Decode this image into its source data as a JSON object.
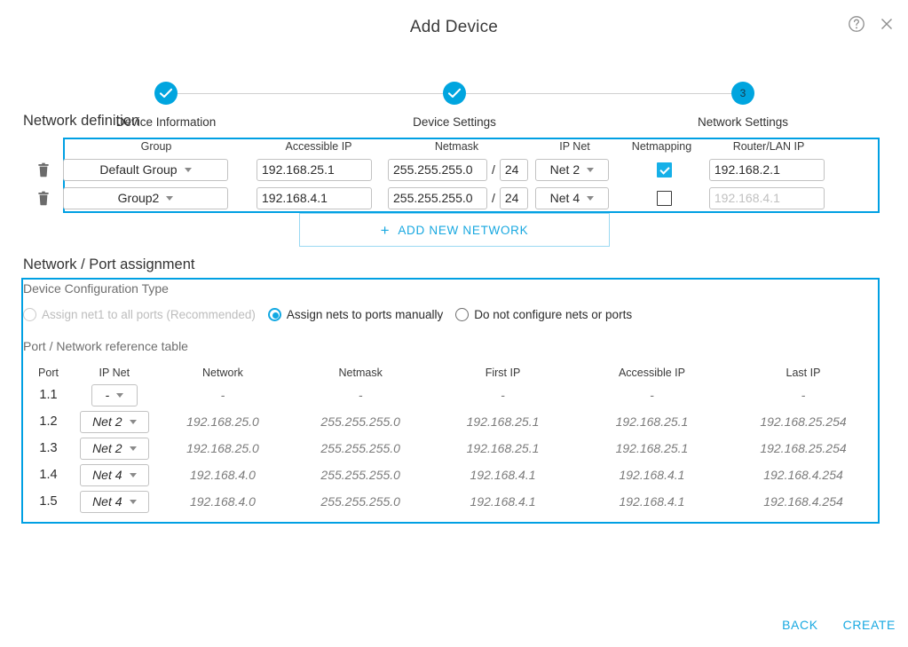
{
  "window": {
    "title": "Add Device",
    "help_icon": "help-circle-icon",
    "close_icon": "close-icon"
  },
  "colors": {
    "accent": "#00a0e3",
    "accent_bright": "#16b0e8",
    "link": "#19a9e1",
    "disabled_text": "#bdbdbd",
    "value_text": "#7b7b7b"
  },
  "stepper": {
    "steps": [
      {
        "label": "Device Information",
        "state": "complete",
        "marker": "check"
      },
      {
        "label": "Device Settings",
        "state": "complete",
        "marker": "check"
      },
      {
        "label": "Network Settings",
        "state": "current",
        "marker": "3"
      }
    ]
  },
  "network_definition": {
    "heading": "Network definition",
    "columns": [
      "Group",
      "Accessible IP",
      "Netmask",
      "IP Net",
      "Netmapping",
      "Router/LAN IP"
    ],
    "slash": "/",
    "rows": [
      {
        "delete_icon": "trash-icon",
        "group": "Default Group",
        "accessible_ip": "192.168.25.1",
        "netmask": "255.255.255.0",
        "cidr": "24",
        "ip_net": "Net 2",
        "netmapping": true,
        "router_lan_ip": "192.168.2.1",
        "router_lan_ip_is_placeholder": false
      },
      {
        "delete_icon": "trash-icon",
        "group": "Group2",
        "accessible_ip": "192.168.4.1",
        "netmask": "255.255.255.0",
        "cidr": "24",
        "ip_net": "Net 4",
        "netmapping": false,
        "router_lan_ip": "192.168.4.1",
        "router_lan_ip_is_placeholder": true
      }
    ],
    "add_button": {
      "label": "ADD NEW NETWORK",
      "icon": "plus-icon"
    }
  },
  "port_assignment": {
    "heading": "Network / Port assignment",
    "config_type_label": "Device Configuration Type",
    "options": [
      {
        "label": "Assign net1 to all ports (Recommended)",
        "selected": false,
        "disabled": true
      },
      {
        "label": "Assign nets to ports manually",
        "selected": true,
        "disabled": false
      },
      {
        "label": "Do not configure nets or ports",
        "selected": false,
        "disabled": false
      }
    ],
    "reference_table_label": "Port / Network reference table",
    "table": {
      "columns": [
        "Port",
        "IP Net",
        "Network",
        "Netmask",
        "First IP",
        "Accessible IP",
        "Last IP"
      ],
      "rows": [
        {
          "port": "1.1",
          "ip_net": "-",
          "network": "-",
          "netmask": "-",
          "first_ip": "-",
          "accessible_ip": "-",
          "last_ip": "-"
        },
        {
          "port": "1.2",
          "ip_net": "Net 2",
          "network": "192.168.25.0",
          "netmask": "255.255.255.0",
          "first_ip": "192.168.25.1",
          "accessible_ip": "192.168.25.1",
          "last_ip": "192.168.25.254"
        },
        {
          "port": "1.3",
          "ip_net": "Net 2",
          "network": "192.168.25.0",
          "netmask": "255.255.255.0",
          "first_ip": "192.168.25.1",
          "accessible_ip": "192.168.25.1",
          "last_ip": "192.168.25.254"
        },
        {
          "port": "1.4",
          "ip_net": "Net 4",
          "network": "192.168.4.0",
          "netmask": "255.255.255.0",
          "first_ip": "192.168.4.1",
          "accessible_ip": "192.168.4.1",
          "last_ip": "192.168.4.254"
        },
        {
          "port": "1.5",
          "ip_net": "Net 4",
          "network": "192.168.4.0",
          "netmask": "255.255.255.0",
          "first_ip": "192.168.4.1",
          "accessible_ip": "192.168.4.1",
          "last_ip": "192.168.4.254"
        }
      ]
    }
  },
  "footer": {
    "back_label": "BACK",
    "create_label": "CREATE"
  }
}
